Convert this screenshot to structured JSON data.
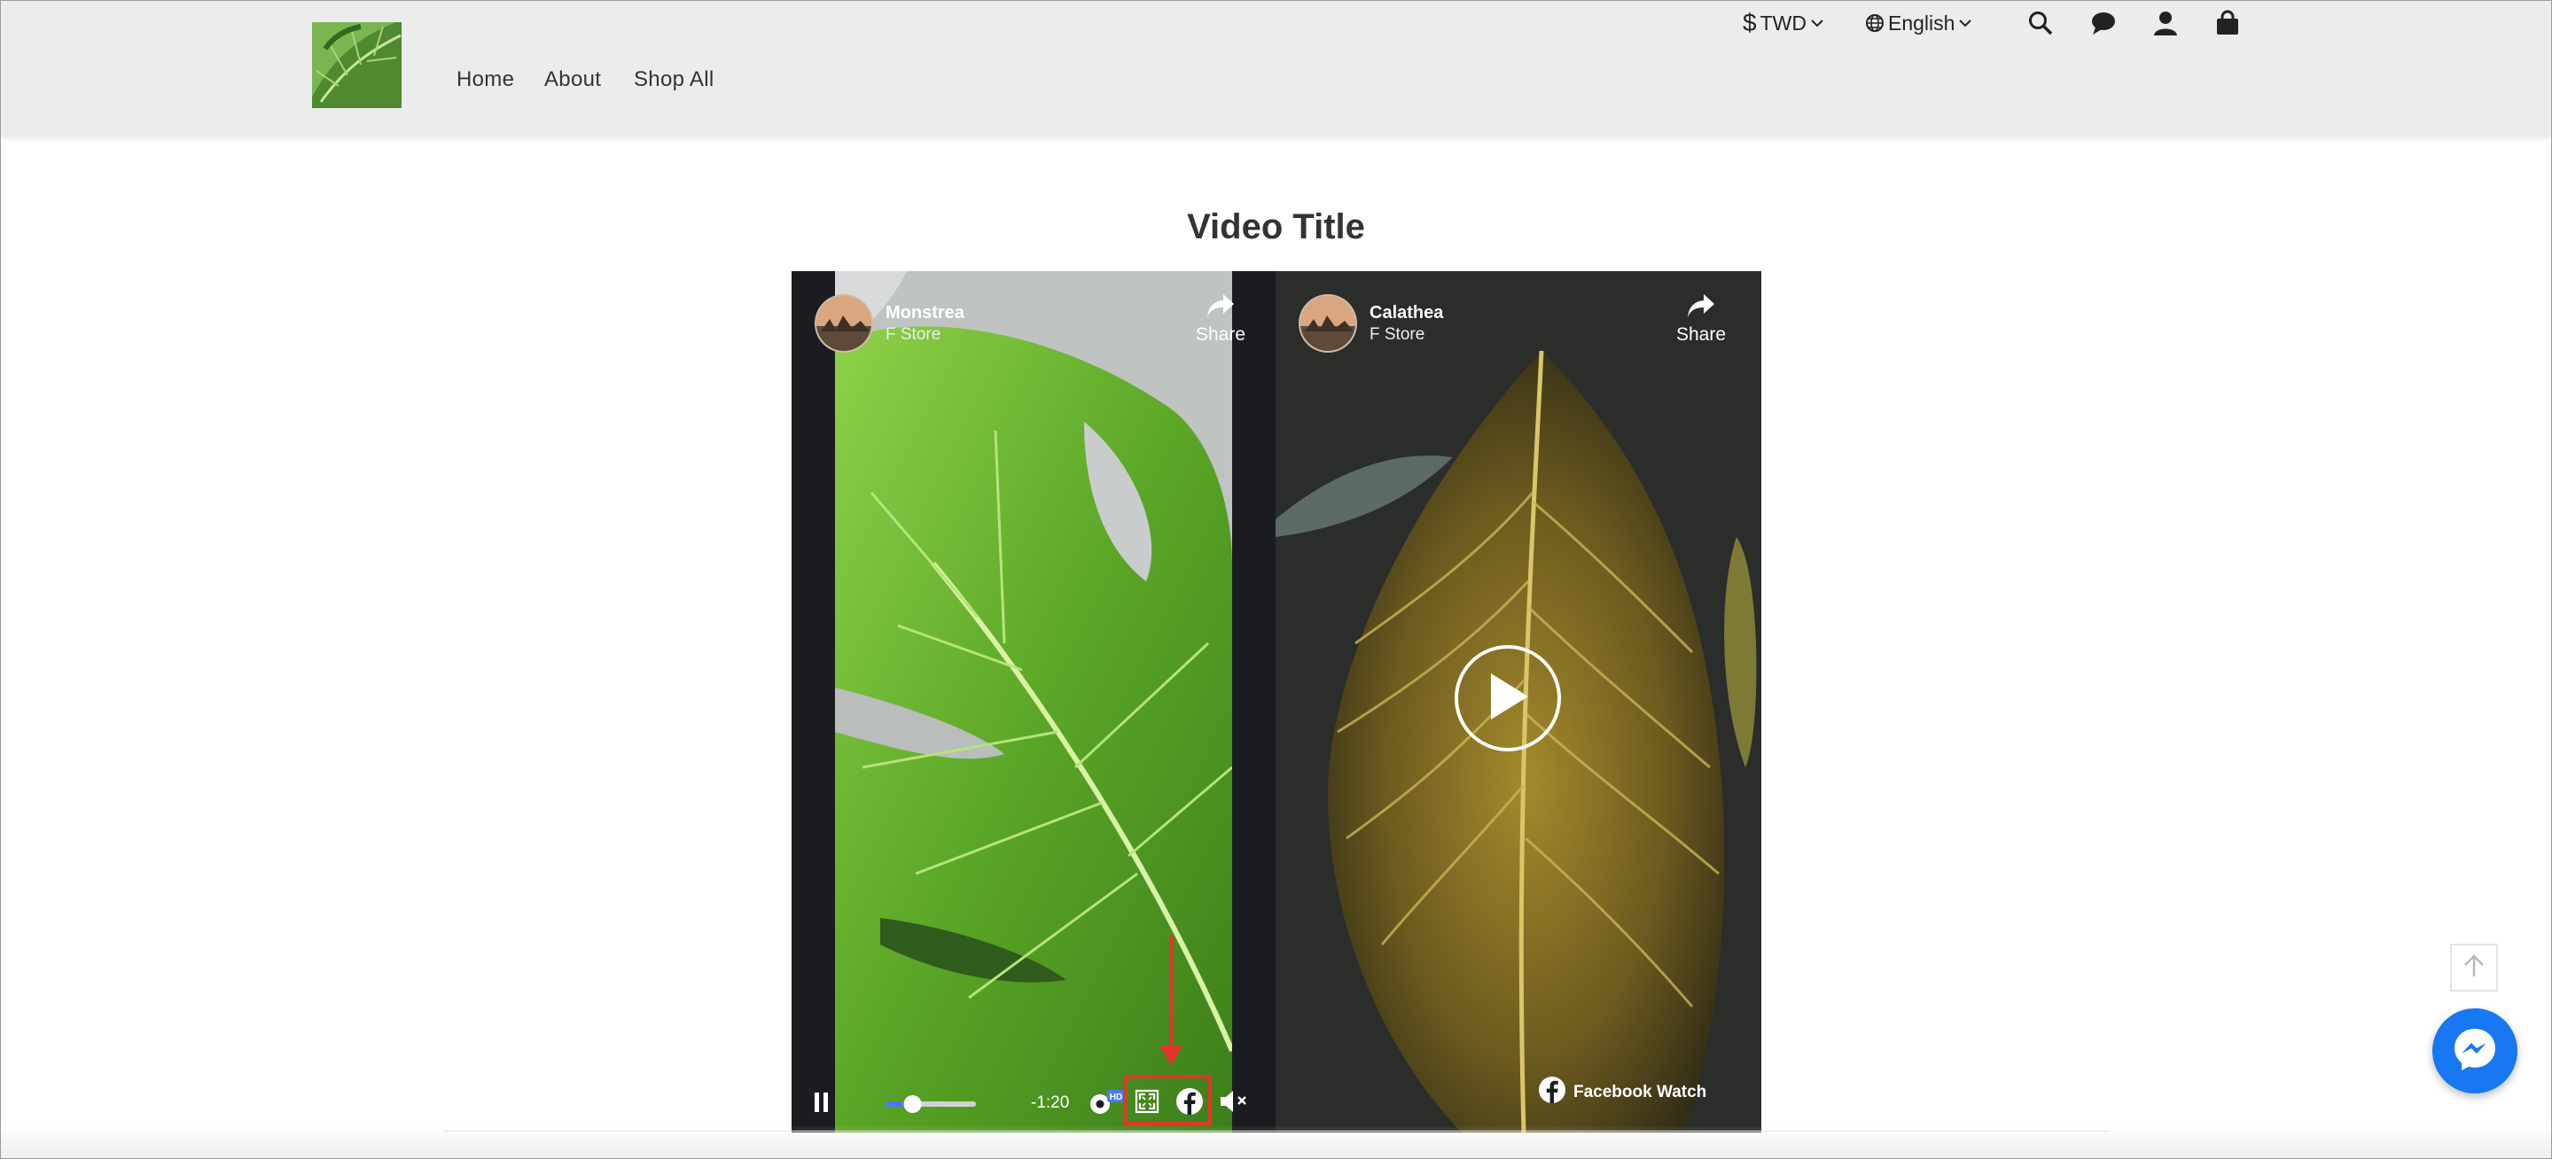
{
  "header": {
    "nav": [
      {
        "label": "Home"
      },
      {
        "label": "About"
      },
      {
        "label": "Shop All"
      }
    ],
    "currency": {
      "symbol": "$",
      "label": "TWD"
    },
    "language": {
      "label": "English"
    },
    "icons": [
      "search-icon",
      "chat-icon",
      "account-icon",
      "shopping-bag-icon"
    ]
  },
  "section": {
    "title": "Video Title"
  },
  "videos": [
    {
      "name": "Monstrea",
      "page": "F Store",
      "share_label": "Share",
      "time_remaining": "-1:20",
      "quality_badge": "HD",
      "progress": 0.3
    },
    {
      "name": "Calathea",
      "page": "F Store",
      "share_label": "Share",
      "footer_label": "Facebook Watch"
    }
  ],
  "colors": {
    "header_bg": "#ececec",
    "highlight": "#e5352a",
    "messenger": "#1877f2",
    "progress": "#4a7cf3"
  }
}
